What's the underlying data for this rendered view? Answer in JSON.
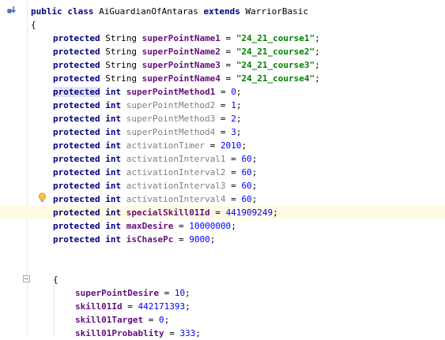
{
  "editor": {
    "lines": [
      {
        "id": "class_decl",
        "tokens": [
          [
            "public class ",
            "kw"
          ],
          [
            "AiGuardianOfAntaras ",
            "plain"
          ],
          [
            "extends ",
            "kw"
          ],
          [
            "WarriorBasic",
            "plain"
          ]
        ]
      },
      {
        "id": "open_brace",
        "tokens": [
          [
            "{",
            "plain"
          ]
        ]
      },
      {
        "id": "l1",
        "tokens": [
          [
            "protected ",
            "kw"
          ],
          [
            "String ",
            "plain"
          ],
          [
            "superPointName1",
            "id-purple"
          ],
          [
            " = ",
            "plain"
          ],
          [
            "\"24_21_course1\"",
            "str"
          ],
          [
            ";",
            "plain"
          ]
        ]
      },
      {
        "id": "l2",
        "tokens": [
          [
            "protected ",
            "kw"
          ],
          [
            "String ",
            "plain"
          ],
          [
            "superPointName2",
            "id-purple"
          ],
          [
            " = ",
            "plain"
          ],
          [
            "\"24_21_course2\"",
            "str"
          ],
          [
            ";",
            "plain"
          ]
        ]
      },
      {
        "id": "l3",
        "tokens": [
          [
            "protected ",
            "kw"
          ],
          [
            "String ",
            "plain"
          ],
          [
            "superPointName3",
            "id-purple"
          ],
          [
            " = ",
            "plain"
          ],
          [
            "\"24_21_course3\"",
            "str"
          ],
          [
            ";",
            "plain"
          ]
        ]
      },
      {
        "id": "l4",
        "tokens": [
          [
            "protected ",
            "kw"
          ],
          [
            "String ",
            "plain"
          ],
          [
            "superPointName4",
            "id-purple"
          ],
          [
            " = ",
            "plain"
          ],
          [
            "\"24_21_course4\"",
            "str"
          ],
          [
            ";",
            "plain"
          ]
        ]
      },
      {
        "id": "l5",
        "tokens": [
          [
            "protected",
            "caret-kw"
          ],
          [
            " int ",
            "kw"
          ],
          [
            "superPointMethod1",
            "id-purple"
          ],
          [
            " = ",
            "plain"
          ],
          [
            "0",
            "num"
          ],
          [
            ";",
            "plain"
          ]
        ]
      },
      {
        "id": "l6",
        "tokens": [
          [
            "protected int ",
            "kw"
          ],
          [
            "superPointMethod2",
            "id-gray"
          ],
          [
            " = ",
            "plain"
          ],
          [
            "1",
            "num"
          ],
          [
            ";",
            "plain"
          ]
        ]
      },
      {
        "id": "l7",
        "tokens": [
          [
            "protected int ",
            "kw"
          ],
          [
            "superPointMethod3",
            "id-gray"
          ],
          [
            " = ",
            "plain"
          ],
          [
            "2",
            "num"
          ],
          [
            ";",
            "plain"
          ]
        ]
      },
      {
        "id": "l8",
        "tokens": [
          [
            "protected int ",
            "kw"
          ],
          [
            "superPointMethod4",
            "id-gray"
          ],
          [
            " = ",
            "plain"
          ],
          [
            "3",
            "num"
          ],
          [
            ";",
            "plain"
          ]
        ]
      },
      {
        "id": "l9",
        "tokens": [
          [
            "protected int ",
            "kw"
          ],
          [
            "activationTimer",
            "id-gray"
          ],
          [
            " = ",
            "plain"
          ],
          [
            "2010",
            "num"
          ],
          [
            ";",
            "plain"
          ]
        ]
      },
      {
        "id": "l10",
        "tokens": [
          [
            "protected int ",
            "kw"
          ],
          [
            "activationInterval1",
            "id-gray"
          ],
          [
            " = ",
            "plain"
          ],
          [
            "60",
            "num"
          ],
          [
            ";",
            "plain"
          ]
        ]
      },
      {
        "id": "l11",
        "tokens": [
          [
            "protected int ",
            "kw"
          ],
          [
            "activationInterval2",
            "id-gray"
          ],
          [
            " = ",
            "plain"
          ],
          [
            "60",
            "num"
          ],
          [
            ";",
            "plain"
          ]
        ]
      },
      {
        "id": "l12",
        "tokens": [
          [
            "protected int ",
            "kw"
          ],
          [
            "activationInterval3",
            "id-gray"
          ],
          [
            " = ",
            "plain"
          ],
          [
            "60",
            "num"
          ],
          [
            ";",
            "plain"
          ]
        ]
      },
      {
        "id": "l13",
        "tokens": [
          [
            "protected int ",
            "kw"
          ],
          [
            "activationInterval4",
            "id-gray"
          ],
          [
            " = ",
            "plain"
          ],
          [
            "60",
            "num"
          ],
          [
            ";",
            "plain"
          ]
        ]
      },
      {
        "id": "l14",
        "tokens": [
          [
            "protected int ",
            "kw"
          ],
          [
            "specialSkill01Id",
            "id-purple"
          ],
          [
            " = ",
            "plain"
          ],
          [
            "441909249",
            "num"
          ],
          [
            ";",
            "plain"
          ]
        ]
      },
      {
        "id": "l15",
        "tokens": [
          [
            "protected int ",
            "kw"
          ],
          [
            "maxDesire",
            "id-purple"
          ],
          [
            " = ",
            "plain"
          ],
          [
            "10000000",
            "num"
          ],
          [
            ";",
            "plain"
          ]
        ]
      },
      {
        "id": "l16",
        "tokens": [
          [
            "protected int ",
            "kw"
          ],
          [
            "isChasePc",
            "id-purple"
          ],
          [
            " = ",
            "plain"
          ],
          [
            "9000",
            "num"
          ],
          [
            ";",
            "plain"
          ]
        ]
      },
      {
        "id": "b1",
        "tokens": []
      },
      {
        "id": "b2",
        "tokens": []
      },
      {
        "id": "init_brace",
        "tokens": [
          [
            "{",
            "plain"
          ]
        ]
      },
      {
        "id": "l17",
        "tokens": [
          [
            "superPointDesire",
            "id-purple"
          ],
          [
            " = ",
            "plain"
          ],
          [
            "10",
            "num"
          ],
          [
            ";",
            "plain"
          ]
        ]
      },
      {
        "id": "l18",
        "tokens": [
          [
            "skill01Id",
            "id-purple"
          ],
          [
            " = ",
            "plain"
          ],
          [
            "442171393",
            "num"
          ],
          [
            ";",
            "plain"
          ]
        ]
      },
      {
        "id": "l19",
        "tokens": [
          [
            "skill01Target",
            "id-purple"
          ],
          [
            " = ",
            "plain"
          ],
          [
            "0",
            "num"
          ],
          [
            ";",
            "plain"
          ]
        ]
      },
      {
        "id": "l20",
        "tokens": [
          [
            "skill01Probablity",
            "id-purple"
          ],
          [
            " = ",
            "plain"
          ],
          [
            "333",
            "num"
          ],
          [
            ";",
            "plain"
          ]
        ]
      }
    ]
  },
  "gutter": {
    "override_icon": "override-arrow-icon",
    "bulb_icon": "lightbulb-icon",
    "fold_icon": "fold-marker-icon"
  },
  "colors": {
    "keyword": "#000080",
    "field": "#660e7a",
    "unused_field": "#808080",
    "string": "#008000",
    "number": "#0000ff",
    "current_line": "#fffae3"
  }
}
